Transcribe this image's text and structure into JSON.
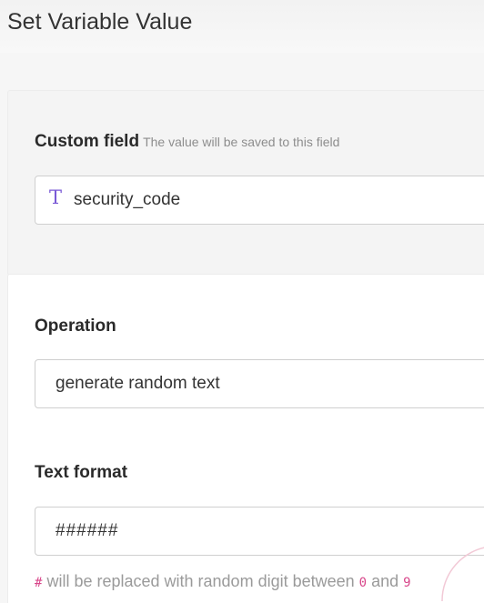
{
  "page": {
    "title": "Set Variable Value"
  },
  "custom_field": {
    "label": "Custom field",
    "hint": "The value will be saved to this field",
    "value": "security_code",
    "type_icon": "text-type-icon",
    "icon_color": "#7a5ad6"
  },
  "operation": {
    "label": "Operation",
    "value": "generate random text"
  },
  "text_format": {
    "label": "Text format",
    "value": "######",
    "help": {
      "hash": "#",
      "part1": "will be replaced with random digit between",
      "min": "0",
      "and": "and",
      "max": "9"
    },
    "code_color": "#d8468a"
  }
}
